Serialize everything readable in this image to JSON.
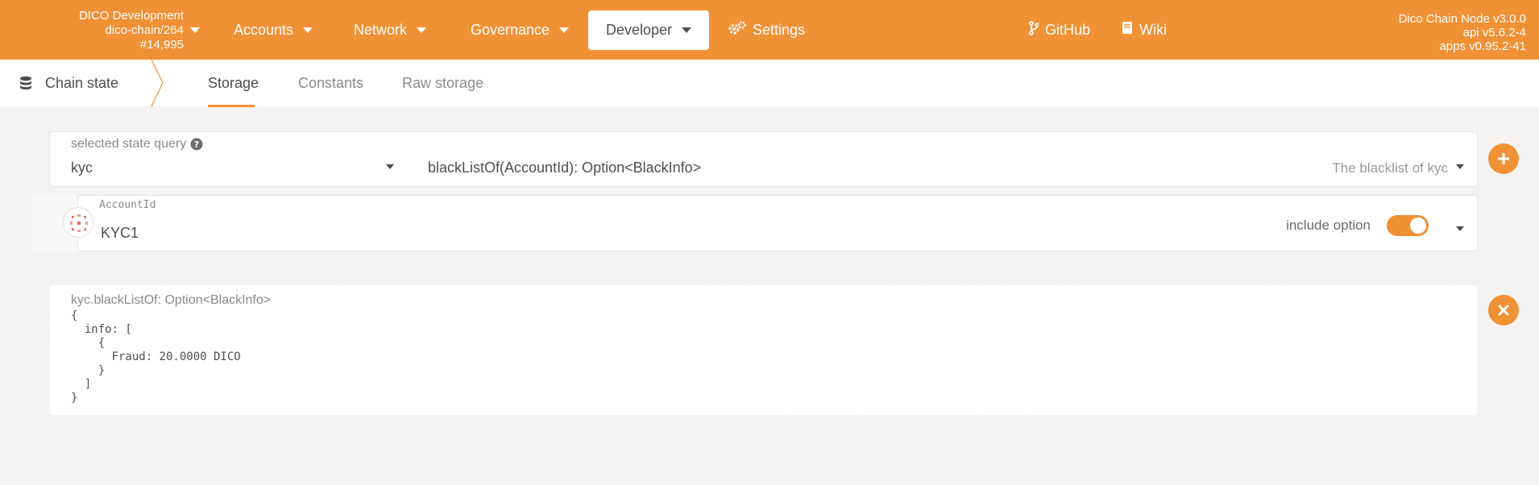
{
  "header": {
    "chain_name": "DICO Development",
    "chain_spec": "dico-chain/264",
    "block_number": "#14,995",
    "nav": [
      {
        "label": "Accounts"
      },
      {
        "label": "Network"
      },
      {
        "label": "Governance"
      },
      {
        "label": "Developer"
      },
      {
        "label": "Settings",
        "icon": "gears-icon"
      },
      {
        "label": "GitHub",
        "icon": "code-branch-icon"
      },
      {
        "label": "Wiki",
        "icon": "book-icon"
      }
    ],
    "node_name": "Dico Chain Node v3.0.0",
    "api_version": "api v5.6.2-4",
    "apps_version": "apps v0.95.2-41"
  },
  "subnav": {
    "title": "Chain state",
    "title_icon": "database-icon",
    "tabs": [
      {
        "label": "Storage",
        "active": true
      },
      {
        "label": "Constants",
        "active": false
      },
      {
        "label": "Raw storage",
        "active": false
      }
    ]
  },
  "query": {
    "label": "selected state query",
    "module": "kyc",
    "method": "blackListOf(AccountId): Option<BlackInfo>",
    "doc": "The blacklist of kyc"
  },
  "param": {
    "label": "AccountId",
    "value": "KYC1",
    "include_option_label": "include option",
    "include_option": true
  },
  "result": {
    "label": "kyc.blackListOf: Option<BlackInfo>",
    "code": "{\n  info: [\n    {\n      Fraud: 20.0000 DICO\n    }\n  ]\n}"
  },
  "colors": {
    "accent": "#f19135",
    "background": "#f4f3f1",
    "text": "#4e4e4e"
  }
}
